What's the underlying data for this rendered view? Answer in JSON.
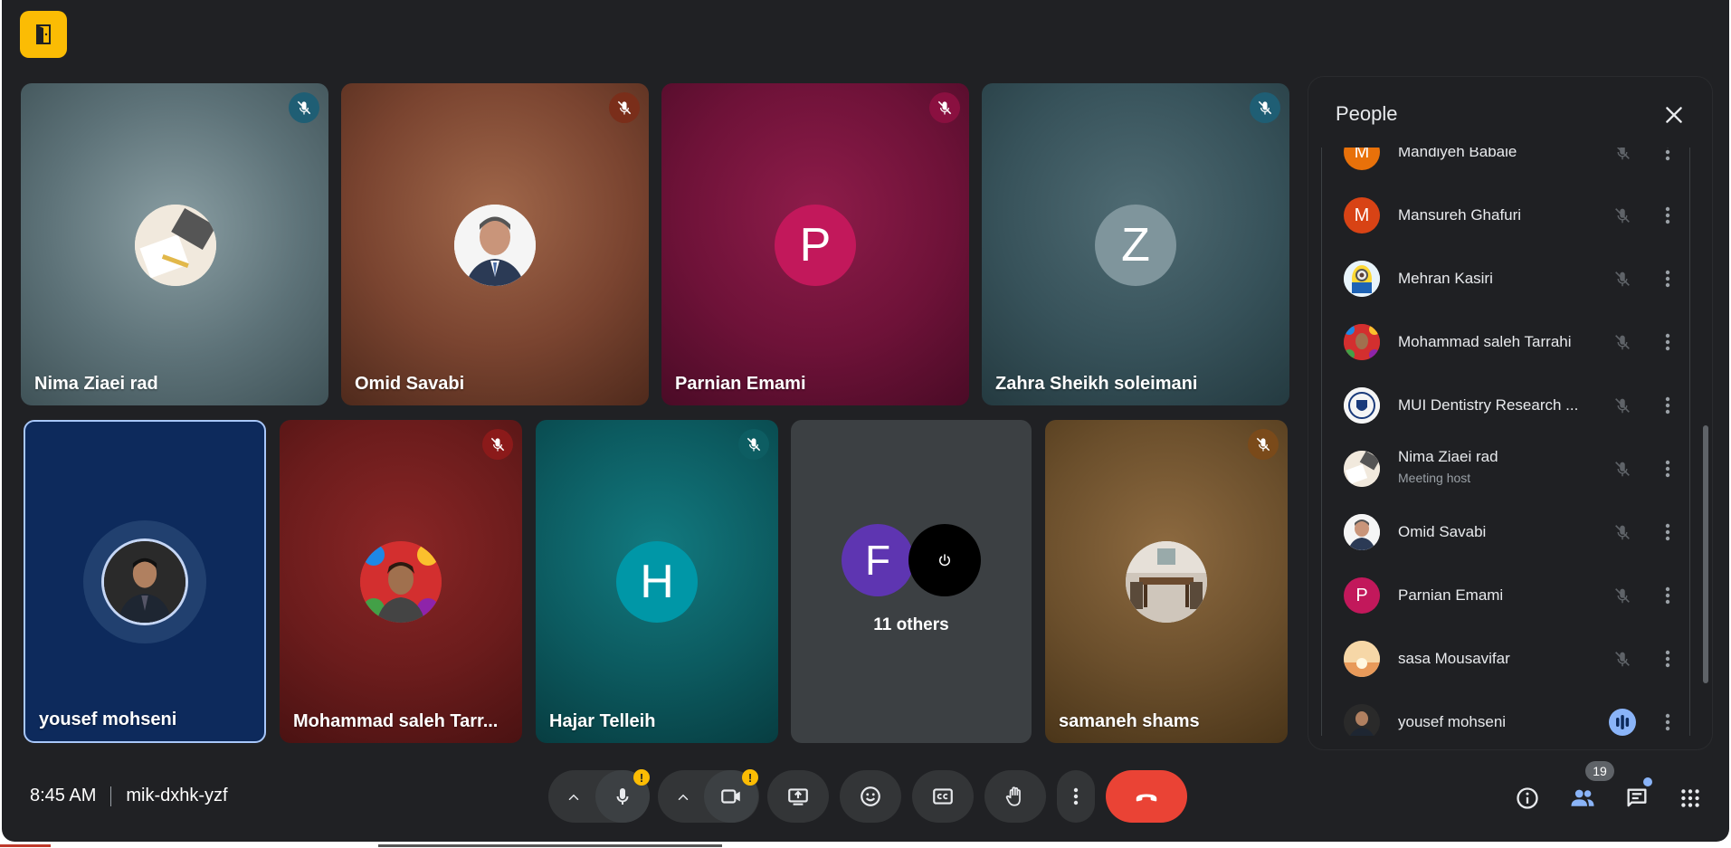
{
  "tiles_row1": [
    {
      "name": "Nima Ziaei rad",
      "avatar": "photo-desk",
      "mute_color": "#1f5e74"
    },
    {
      "name": "Omid Savabi",
      "avatar": "photo-man",
      "mute_color": "#7a2e1a"
    },
    {
      "name": "Parnian Emami",
      "avatar_letter": "P",
      "avatar_color": "#c2185b",
      "mute_color": "#8a1040"
    },
    {
      "name": "Zahra Sheikh soleimani",
      "avatar_letter": "Z",
      "avatar_color": "#7f959c",
      "mute_color": "#1f5e74"
    }
  ],
  "tiles_row2": [
    {
      "name": "yousef mohseni",
      "avatar": "photo-self",
      "speaking": true
    },
    {
      "name": "Mohammad saleh Tarr...",
      "avatar": "photo-stained",
      "mute_color": "#8b1a1a"
    },
    {
      "name": "Hajar Telleih",
      "avatar_letter": "H",
      "avatar_color": "#0097a7",
      "mute_color": "#0d5d62"
    },
    {
      "others_label": "11 others",
      "letter_f": "F",
      "letter_f_color": "#5e35b1"
    },
    {
      "name": "samaneh shams",
      "avatar": "photo-room",
      "mute_color": "#7a4a1a"
    }
  ],
  "people_panel": {
    "title": "People",
    "participants": [
      {
        "name": "Mandiyeh Babaie",
        "letter": "M",
        "color": "#e8710a"
      },
      {
        "name": "Mansureh Ghafuri",
        "letter": "M",
        "color": "#d84315"
      },
      {
        "name": "Mehran Kasiri",
        "avatar": "minion"
      },
      {
        "name": "Mohammad saleh Tarrahi",
        "avatar": "stained"
      },
      {
        "name": "MUI Dentistry Research ...",
        "avatar": "seal"
      },
      {
        "name": "Nima Ziaei rad",
        "sub": "Meeting host",
        "avatar": "desk"
      },
      {
        "name": "Omid Savabi",
        "avatar": "man"
      },
      {
        "name": "Parnian Emami",
        "letter": "P",
        "color": "#c2185b"
      },
      {
        "name": "sasa Mousavifar",
        "avatar": "sunset"
      },
      {
        "name": "yousef mohseni",
        "avatar": "self",
        "speaking": true
      }
    ]
  },
  "bottom": {
    "time": "8:45 AM",
    "meeting_code": "mik-dxhk-yzf",
    "people_count": "19",
    "warn_symbol": "!"
  }
}
